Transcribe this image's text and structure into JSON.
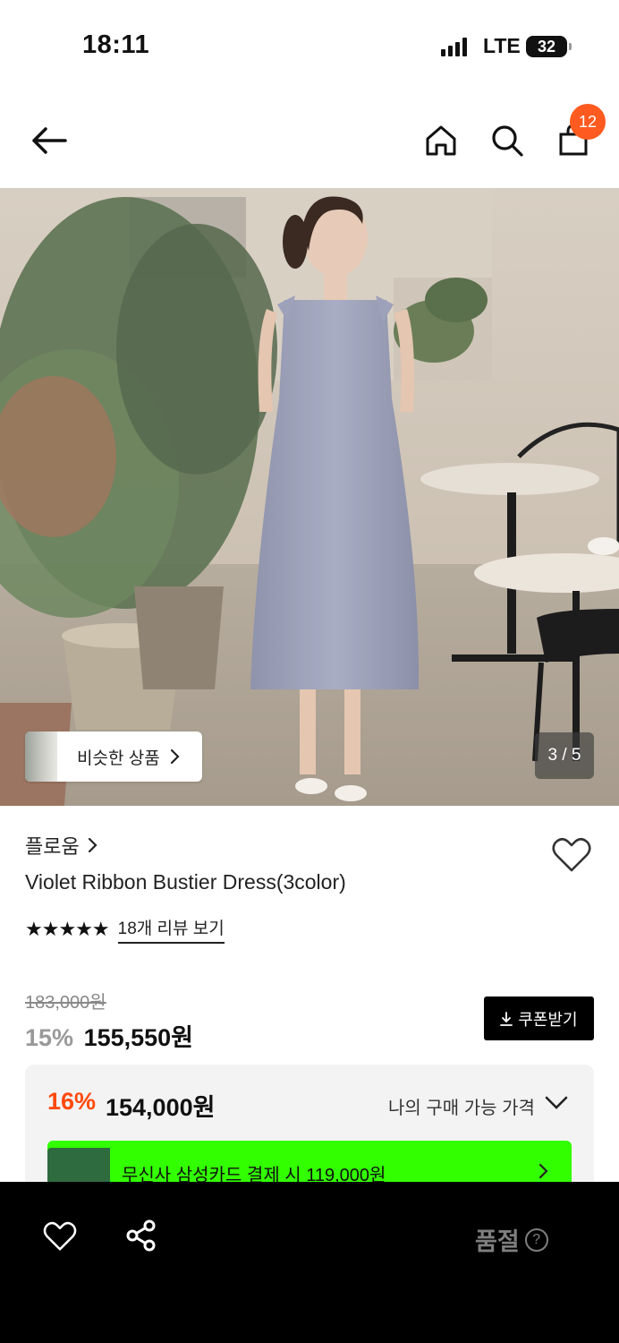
{
  "status_bar": {
    "time": "18:11",
    "network": "LTE",
    "battery": "32"
  },
  "header": {
    "cart_count": "12"
  },
  "hero": {
    "similar_label": "비슷한 상품",
    "counter": "3 / 5"
  },
  "product": {
    "brand": "플로움",
    "name": "Violet Ribbon Bustier Dress(3color)",
    "stars": "★★★★★",
    "review_link": "18개 리뷰 보기",
    "original_price": "183,000원",
    "sale_rate": "15%",
    "sale_price": "155,550원",
    "coupon_label": "쿠폰받기"
  },
  "best_price": {
    "rate": "16%",
    "price": "154,000원",
    "label": "나의 구매 가능 가격",
    "card_offer": "무신사 삼성카드 결제 시 119,000원"
  },
  "bottom_bar": {
    "status": "품절",
    "help": "?"
  },
  "colors": {
    "accent": "#ff4a0d",
    "badge": "#ff5a1f",
    "card_banner": "#32ff00"
  },
  "icons": [
    "back-arrow-icon",
    "home-icon",
    "search-icon",
    "cart-icon",
    "heart-icon",
    "share-icon",
    "chevron-right-icon",
    "chevron-down-icon",
    "download-icon",
    "help-icon"
  ]
}
